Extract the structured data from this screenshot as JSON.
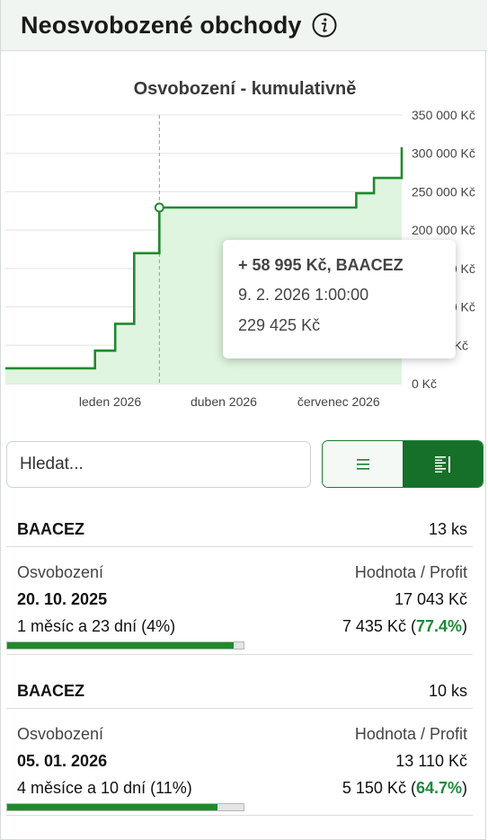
{
  "header": {
    "title": "Neosvobozené obchody",
    "info_icon": "info-icon"
  },
  "chart_data": {
    "type": "line",
    "step": true,
    "area_fill": true,
    "title": "Osvobození - kumulativně",
    "xlabel": "",
    "ylabel": "",
    "y_axis_side": "right",
    "ylim": [
      0,
      350000
    ],
    "y_ticks": [
      {
        "value": 0,
        "label": "0 Kč"
      },
      {
        "value": 50000,
        "label": "50 000 Kč"
      },
      {
        "value": 100000,
        "label": "100 000 Kč"
      },
      {
        "value": 150000,
        "label": "150 000 Kč"
      },
      {
        "value": 200000,
        "label": "200 000 Kč"
      },
      {
        "value": 250000,
        "label": "250 000 Kč"
      },
      {
        "value": 300000,
        "label": "300 000 Kč"
      },
      {
        "value": 350000,
        "label": "350 000 Kč"
      }
    ],
    "xlim": [
      "2025-10-10",
      "2026-08-20"
    ],
    "x_ticks": [
      {
        "value": "2026-01-01",
        "label": "leden 2026"
      },
      {
        "value": "2026-04-01",
        "label": "duben 2026"
      },
      {
        "value": "2026-07-01",
        "label": "červenec 2026"
      }
    ],
    "series": [
      {
        "color": "#1f8a2c",
        "fill_color": "#dff5df",
        "points": [
          [
            "2025-10-10",
            20000
          ],
          [
            "2025-12-20",
            20000
          ],
          [
            "2025-12-20",
            43000
          ],
          [
            "2026-01-05",
            43000
          ],
          [
            "2026-01-05",
            78000
          ],
          [
            "2026-01-20",
            78000
          ],
          [
            "2026-01-20",
            170000
          ],
          [
            "2026-02-09",
            170000
          ],
          [
            "2026-02-09",
            229425
          ],
          [
            "2026-07-15",
            229425
          ],
          [
            "2026-07-15",
            248000
          ],
          [
            "2026-07-29",
            248000
          ],
          [
            "2026-07-29",
            268000
          ],
          [
            "2026-08-20",
            268000
          ],
          [
            "2026-08-20",
            308000
          ]
        ]
      }
    ],
    "hover": {
      "date": "2026-02-09",
      "value": 229425,
      "line1": "+ 58 995 Kč, BAACEZ",
      "line2": "9. 2. 2026 1:00:00",
      "line3": "229 425 Kč"
    },
    "grid": true,
    "legend": "none"
  },
  "search": {
    "placeholder": "Hledat..."
  },
  "view_toggle": {
    "list_icon": "list-icon",
    "detail_icon": "detail-list-icon",
    "active": "detail"
  },
  "positions": [
    {
      "ticker": "BAACEZ",
      "qty": "13 ks",
      "label_left": "Osvobození",
      "label_right": "Hodnota / Profit",
      "date": "20. 10. 2025",
      "value": "17 043 Kč",
      "remaining": "1 měsíc a 23 dní (4%)",
      "profit": "7 435 Kč",
      "profit_pct": "77.4%",
      "progress": 0.96
    },
    {
      "ticker": "BAACEZ",
      "qty": "10 ks",
      "label_left": "Osvobození",
      "label_right": "Hodnota / Profit",
      "date": "05. 01. 2026",
      "value": "13 110 Kč",
      "remaining": "4 měsíce a 10 dní (11%)",
      "profit": "5 150 Kč",
      "profit_pct": "64.7%",
      "progress": 0.89
    }
  ]
}
